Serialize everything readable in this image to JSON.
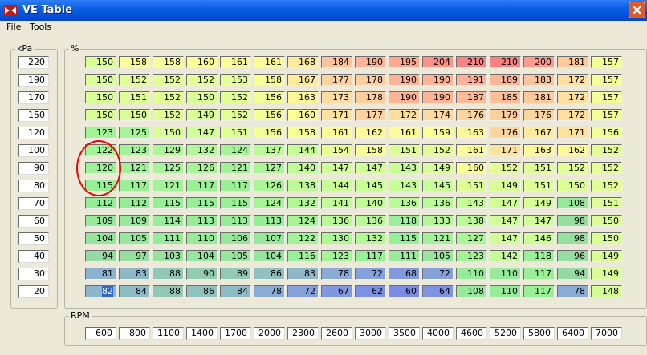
{
  "window": {
    "title": "VE Table"
  },
  "menu": {
    "file": "File",
    "tools": "Tools"
  },
  "load_axis": {
    "label": "kPa",
    "values": [
      "220",
      "190",
      "170",
      "150",
      "120",
      "100",
      "90",
      "80",
      "70",
      "60",
      "50",
      "40",
      "30",
      "20"
    ]
  },
  "table": {
    "label": "%",
    "rows": [
      [
        150,
        158,
        158,
        160,
        161,
        161,
        168,
        184,
        190,
        195,
        204,
        210,
        210,
        200,
        181,
        157
      ],
      [
        150,
        152,
        152,
        152,
        153,
        158,
        167,
        177,
        178,
        190,
        190,
        191,
        189,
        183,
        172,
        157
      ],
      [
        150,
        151,
        152,
        150,
        152,
        156,
        163,
        173,
        178,
        190,
        190,
        187,
        185,
        181,
        172,
        157
      ],
      [
        150,
        150,
        152,
        149,
        152,
        156,
        160,
        171,
        177,
        172,
        174,
        176,
        179,
        176,
        172,
        157
      ],
      [
        123,
        125,
        150,
        147,
        151,
        156,
        158,
        161,
        162,
        161,
        159,
        163,
        176,
        167,
        171,
        156
      ],
      [
        122,
        123,
        129,
        132,
        124,
        137,
        144,
        154,
        158,
        151,
        152,
        161,
        171,
        163,
        162,
        152
      ],
      [
        120,
        121,
        125,
        126,
        121,
        127,
        140,
        147,
        147,
        143,
        149,
        160,
        152,
        151,
        152,
        152
      ],
      [
        115,
        117,
        121,
        117,
        117,
        126,
        138,
        144,
        145,
        143,
        145,
        151,
        149,
        151,
        150,
        152
      ],
      [
        112,
        112,
        115,
        115,
        115,
        124,
        132,
        141,
        140,
        136,
        136,
        143,
        147,
        149,
        108,
        151
      ],
      [
        109,
        109,
        114,
        113,
        113,
        113,
        124,
        136,
        136,
        118,
        133,
        138,
        147,
        147,
        98,
        150
      ],
      [
        104,
        105,
        111,
        110,
        106,
        107,
        122,
        130,
        132,
        115,
        121,
        127,
        147,
        146,
        98,
        150
      ],
      [
        94,
        97,
        103,
        104,
        105,
        104,
        116,
        123,
        117,
        111,
        105,
        123,
        142,
        118,
        96,
        149
      ],
      [
        81,
        83,
        88,
        90,
        89,
        86,
        83,
        78,
        72,
        68,
        72,
        110,
        110,
        117,
        94,
        149
      ],
      [
        82,
        84,
        88,
        86,
        84,
        78,
        72,
        67,
        62,
        60,
        64,
        108,
        110,
        117,
        78,
        148
      ]
    ]
  },
  "rpm_axis": {
    "label": "RPM",
    "values": [
      "600",
      "800",
      "1100",
      "1400",
      "1700",
      "2000",
      "2300",
      "2600",
      "3000",
      "3500",
      "4000",
      "4600",
      "5200",
      "5800",
      "6400",
      "7000"
    ]
  },
  "colors": {
    "selected": "#316ac5",
    "annotation_circle": "#e00000",
    "titlebar": "#0a5fe5"
  }
}
